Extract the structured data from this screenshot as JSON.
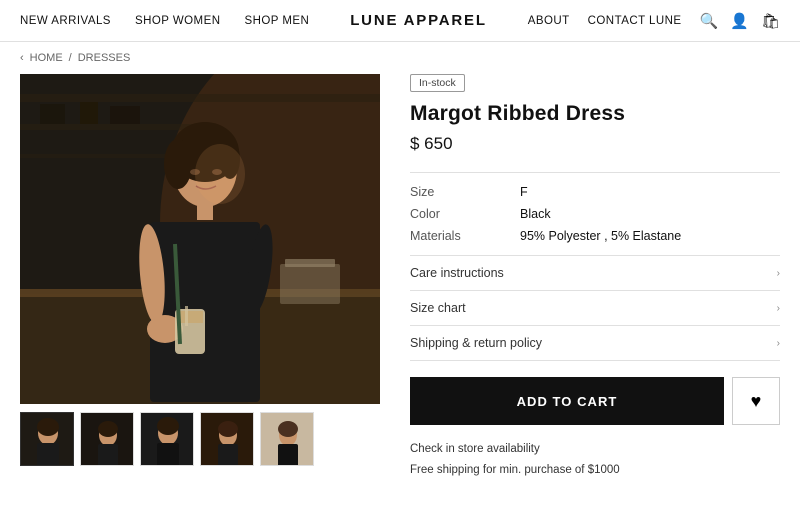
{
  "header": {
    "logo": "LUNE APPAREL",
    "nav_left": [
      {
        "label": "NEW ARRIVALS",
        "id": "new-arrivals"
      },
      {
        "label": "SHOP WOMEN",
        "id": "shop-women"
      },
      {
        "label": "SHOP MEN",
        "id": "shop-men"
      }
    ],
    "nav_right": [
      {
        "label": "ABOUT",
        "id": "about"
      },
      {
        "label": "CONTACT LUNE",
        "id": "contact-lune"
      }
    ]
  },
  "breadcrumb": {
    "back_arrow": "‹",
    "home": "HOME",
    "separator": "/",
    "current": "DRESSES"
  },
  "product": {
    "badge": "In-stock",
    "name": "Margot Ribbed Dress",
    "price": "$ 650",
    "attributes": [
      {
        "label": "Size",
        "value": "F"
      },
      {
        "label": "Color",
        "value": "Black"
      },
      {
        "label": "Materials",
        "value": "95% Polyester , 5% Elastane"
      }
    ],
    "accordion": [
      {
        "label": "Care instructions"
      },
      {
        "label": "Size chart"
      },
      {
        "label": "Shipping & return policy"
      }
    ],
    "add_to_cart": "ADD TO CART",
    "notes": [
      "Check in store availability",
      "Free shipping for min. purchase of $1000"
    ]
  },
  "thumbnails": [
    {
      "id": "thumb-1",
      "active": true
    },
    {
      "id": "thumb-2",
      "active": false
    },
    {
      "id": "thumb-3",
      "active": false
    },
    {
      "id": "thumb-4",
      "active": false
    },
    {
      "id": "thumb-5",
      "active": false
    }
  ]
}
